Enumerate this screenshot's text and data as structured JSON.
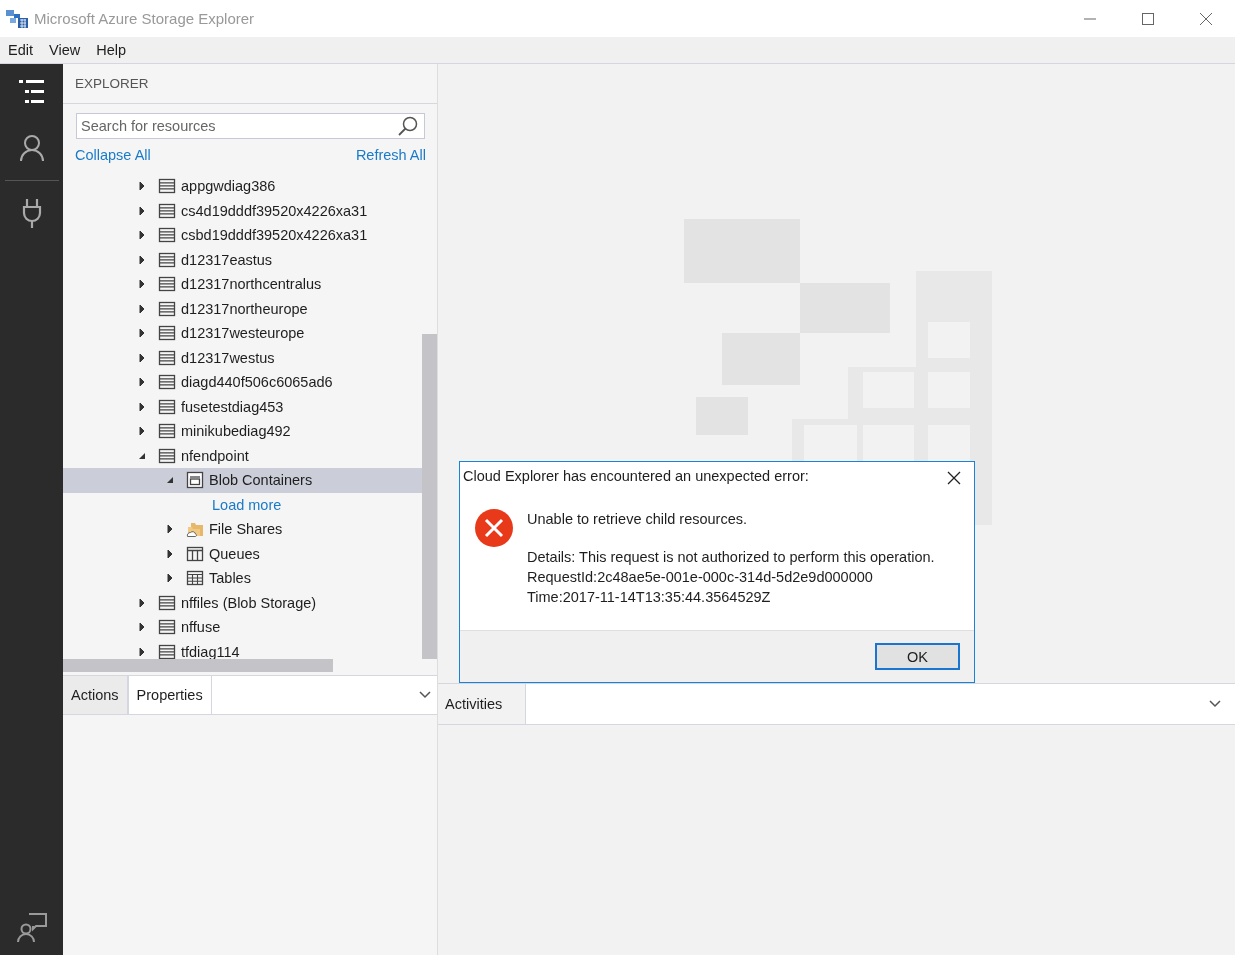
{
  "window": {
    "title": "Microsoft Azure Storage Explorer"
  },
  "menu": [
    "Edit",
    "View",
    "Help"
  ],
  "explorer": {
    "heading": "EXPLORER",
    "search": {
      "placeholder": "Search for resources"
    },
    "collapse_all": "Collapse All",
    "refresh_all": "Refresh All",
    "tree": [
      {
        "label": "appgwdiag386",
        "kind": "account",
        "expanded": false,
        "selected": false
      },
      {
        "label": "cs4d19dddf39520x4226xa31",
        "kind": "account",
        "expanded": false,
        "selected": false
      },
      {
        "label": "csbd19dddf39520x4226xa31",
        "kind": "account",
        "expanded": false,
        "selected": false
      },
      {
        "label": "d12317eastus",
        "kind": "account",
        "expanded": false,
        "selected": false
      },
      {
        "label": "d12317northcentralus",
        "kind": "account",
        "expanded": false,
        "selected": false
      },
      {
        "label": "d12317northeurope",
        "kind": "account",
        "expanded": false,
        "selected": false
      },
      {
        "label": "d12317westeurope",
        "kind": "account",
        "expanded": false,
        "selected": false
      },
      {
        "label": "d12317westus",
        "kind": "account",
        "expanded": false,
        "selected": false
      },
      {
        "label": "diagd440f506c6065ad6",
        "kind": "account",
        "expanded": false,
        "selected": false
      },
      {
        "label": "fusetestdiag453",
        "kind": "account",
        "expanded": false,
        "selected": false
      },
      {
        "label": "minikubediag492",
        "kind": "account",
        "expanded": false,
        "selected": false
      },
      {
        "label": "nfendpoint",
        "kind": "account",
        "expanded": true,
        "selected": false,
        "children": [
          {
            "label": "Blob Containers",
            "kind": "blob",
            "expanded": true,
            "selected": true,
            "children": [
              {
                "label": "Load more",
                "kind": "link",
                "selected": false
              }
            ]
          },
          {
            "label": "File Shares",
            "kind": "fileshare",
            "expanded": false,
            "selected": false
          },
          {
            "label": "Queues",
            "kind": "queue",
            "expanded": false,
            "selected": false
          },
          {
            "label": "Tables",
            "kind": "table",
            "expanded": false,
            "selected": false
          }
        ]
      },
      {
        "label": "nffiles (Blob Storage)",
        "kind": "account",
        "expanded": false,
        "selected": false
      },
      {
        "label": "nffuse",
        "kind": "account",
        "expanded": false,
        "selected": false
      },
      {
        "label": "tfdiag114",
        "kind": "account",
        "expanded": false,
        "selected": false
      }
    ]
  },
  "bottom_left_tabs": [
    {
      "label": "Actions",
      "selected": false
    },
    {
      "label": "Properties",
      "selected": true
    }
  ],
  "bottom_right": {
    "heading": "Activities"
  },
  "dialog": {
    "title": "Cloud Explorer has encountered an unexpected error:",
    "message": "Unable to retrieve child resources.",
    "details": [
      "Details: This request is not authorized to perform this operation.",
      "RequestId:2c48ae5e-001e-000c-314d-5d2e9d000000",
      "Time:2017-11-14T13:35:44.3564529Z"
    ],
    "ok": "OK"
  }
}
